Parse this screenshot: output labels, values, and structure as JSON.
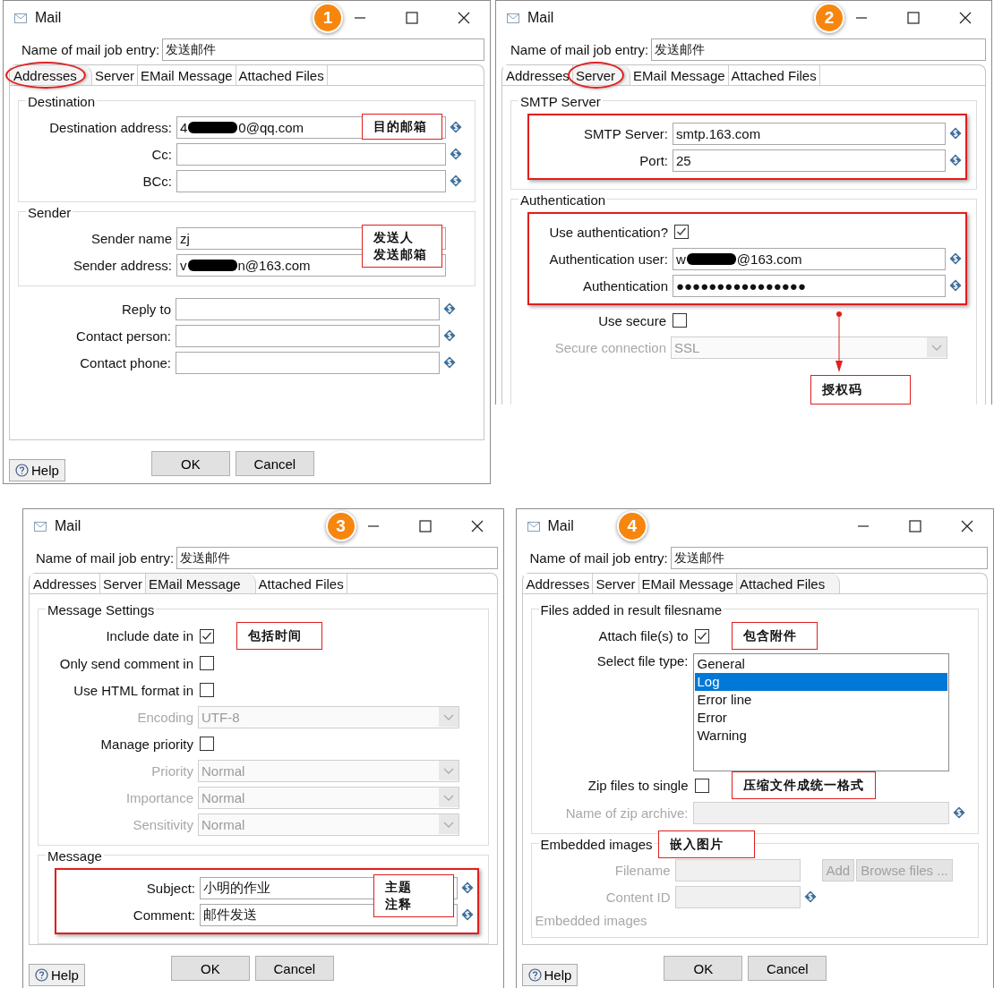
{
  "dialogs": [
    {
      "title": "Mail",
      "badge": "1",
      "name_label": "Name of mail job entry:",
      "name_value": "发送邮件",
      "tabs": [
        {
          "label": "Addresses",
          "selected": true,
          "circled": true
        },
        {
          "label": "Server",
          "selected": false,
          "circled": false
        },
        {
          "label": "EMail Message",
          "selected": false,
          "circled": false
        },
        {
          "label": "Attached Files",
          "selected": false,
          "circled": false
        }
      ],
      "sections": [
        {
          "legend": "Destination",
          "rows": [
            {
              "kind": "field",
              "label": "Destination address:",
              "value": "4",
              "value_end": "0@qq.com",
              "redacted": true,
              "var": true,
              "note": [
                "目的邮箱"
              ]
            },
            {
              "kind": "field",
              "label": "Cc:",
              "var": true
            },
            {
              "kind": "field",
              "label": "BCc:",
              "var": true
            }
          ]
        },
        {
          "legend": "Sender",
          "rows": [
            {
              "kind": "field",
              "label": "Sender name",
              "value": "zj",
              "note": [
                "发送人",
                "发送邮箱"
              ]
            },
            {
              "kind": "field",
              "label": "Sender address:",
              "value": "v",
              "value_end": "n@163.com",
              "redacted": true
            }
          ]
        },
        {
          "rows": [
            {
              "kind": "field",
              "label": "Reply to",
              "var": true
            },
            {
              "kind": "field",
              "label": "Contact person:",
              "var": true
            },
            {
              "kind": "field",
              "label": "Contact phone:",
              "var": true
            }
          ]
        }
      ],
      "buttons": [
        {
          "kind": "help",
          "label": "Help"
        },
        {
          "kind": "action",
          "label": "OK"
        },
        {
          "kind": "action",
          "label": "Cancel"
        }
      ]
    },
    {
      "title": "Mail",
      "badge": "2",
      "name_label": "Name of mail job entry:",
      "name_value": "发送邮件",
      "tabs": [
        {
          "label": "Addresses",
          "selected": false,
          "circled": false
        },
        {
          "label": "Server",
          "selected": true,
          "circled": true
        },
        {
          "label": "EMail Message",
          "selected": false,
          "circled": false
        },
        {
          "label": "Attached Files",
          "selected": false,
          "circled": false
        }
      ],
      "sections": [
        {
          "legend": "SMTP Server",
          "rows": [
            {
              "kind": "highlight",
              "rows": [
                {
                  "kind": "field",
                  "label": "SMTP Server:",
                  "value": "smtp.163.com",
                  "var": true
                },
                {
                  "kind": "field",
                  "label": "Port:",
                  "value": "25",
                  "var": true
                }
              ]
            }
          ]
        },
        {
          "legend": "Authentication",
          "rows": [
            {
              "kind": "highlight",
              "rows": [
                {
                  "kind": "check",
                  "label": "Use authentication?",
                  "checked": true
                },
                {
                  "kind": "field",
                  "label": "Authentication user:",
                  "value": "w",
                  "value_end": "@163.com",
                  "redacted": true,
                  "var": true
                },
                {
                  "kind": "field",
                  "label": "Authentication",
                  "value": "●●●●●●●●●●●●●●●●",
                  "var": true
                }
              ]
            },
            {
              "kind": "check",
              "label": "Use secure",
              "checked": false
            },
            {
              "kind": "combo",
              "label": "Secure connection",
              "value": "SSL",
              "disabled": true
            },
            {
              "kind": "callout",
              "note": [
                "授权码"
              ]
            }
          ]
        }
      ]
    },
    {
      "title": "Mail",
      "badge": "3",
      "name_label": "Name of mail job entry:",
      "name_value": "发送邮件",
      "tabs": [
        {
          "label": "Addresses",
          "selected": false,
          "circled": false
        },
        {
          "label": "Server",
          "selected": false,
          "circled": false
        },
        {
          "label": "EMail Message",
          "selected": true,
          "circled": false
        },
        {
          "label": "Attached Files",
          "selected": false,
          "circled": false
        }
      ],
      "sections": [
        {
          "legend": "Message Settings",
          "rows": [
            {
              "kind": "check",
              "label": "Include date in",
              "checked": true,
              "note": [
                "包括时间"
              ]
            },
            {
              "kind": "check",
              "label": "Only send comment in",
              "checked": false
            },
            {
              "kind": "check",
              "label": "Use HTML format in",
              "checked": false
            },
            {
              "kind": "combo",
              "label": "Encoding",
              "value": "UTF-8",
              "disabled": true
            },
            {
              "kind": "check",
              "label": "Manage priority",
              "checked": false
            },
            {
              "kind": "combo",
              "label": "Priority",
              "value": "Normal",
              "disabled": true
            },
            {
              "kind": "combo",
              "label": "Importance",
              "value": "Normal",
              "disabled": true
            },
            {
              "kind": "combo",
              "label": "Sensitivity",
              "value": "Normal",
              "disabled": true
            }
          ]
        },
        {
          "legend": "Message",
          "rows": [
            {
              "kind": "highlight",
              "rows": [
                {
                  "kind": "field",
                  "label": "Subject:",
                  "value": "小明的作业",
                  "var": true,
                  "note": [
                    "主题",
                    "注释"
                  ]
                },
                {
                  "kind": "field",
                  "label": "Comment:",
                  "value": "邮件发送",
                  "var": true
                }
              ]
            }
          ]
        }
      ],
      "buttons": [
        {
          "kind": "help",
          "label": "Help"
        },
        {
          "kind": "action",
          "label": "OK"
        },
        {
          "kind": "action",
          "label": "Cancel"
        }
      ]
    },
    {
      "title": "Mail",
      "badge": "4",
      "name_label": "Name of mail job entry:",
      "name_value": "发送邮件",
      "tabs": [
        {
          "label": "Addresses",
          "selected": false,
          "circled": false
        },
        {
          "label": "Server",
          "selected": false,
          "circled": false
        },
        {
          "label": "EMail Message",
          "selected": false,
          "circled": false
        },
        {
          "label": "Attached Files",
          "selected": true,
          "circled": false
        }
      ],
      "sections": [
        {
          "legend": "Files added in result filesname",
          "rows": [
            {
              "kind": "check",
              "label": "Attach file(s) to",
              "checked": true,
              "note": [
                "包含附件"
              ]
            },
            {
              "kind": "list",
              "label": "Select file type:",
              "items": [
                {
                  "text": "General",
                  "selected": false
                },
                {
                  "text": "Log",
                  "selected": true
                },
                {
                  "text": "Error line",
                  "selected": false
                },
                {
                  "text": "Error",
                  "selected": false
                },
                {
                  "text": "Warning",
                  "selected": false
                }
              ]
            },
            {
              "kind": "check",
              "label": "Zip files to single",
              "checked": false,
              "note": [
                "压缩文件成统一格式"
              ]
            },
            {
              "kind": "field",
              "label": "Name of zip archive:",
              "disabled": true,
              "var": true
            }
          ]
        },
        {
          "legend": "Embedded images",
          "legend_note": "嵌入图片",
          "compact": true,
          "rows": [
            {
              "kind": "field",
              "label": "Filename",
              "disabled": true,
              "buttons": [
                {
                  "label": "Add",
                  "disabled": true
                },
                {
                  "label": "Browse files ...",
                  "disabled": true
                }
              ]
            },
            {
              "kind": "field",
              "label": "Content ID",
              "disabled": true,
              "var": true
            },
            {
              "kind": "caption",
              "label": "Embedded images",
              "disabled": true
            }
          ]
        }
      ],
      "buttons": [
        {
          "kind": "help",
          "label": "Help"
        },
        {
          "kind": "action",
          "label": "OK"
        },
        {
          "kind": "action",
          "label": "Cancel"
        }
      ]
    }
  ]
}
